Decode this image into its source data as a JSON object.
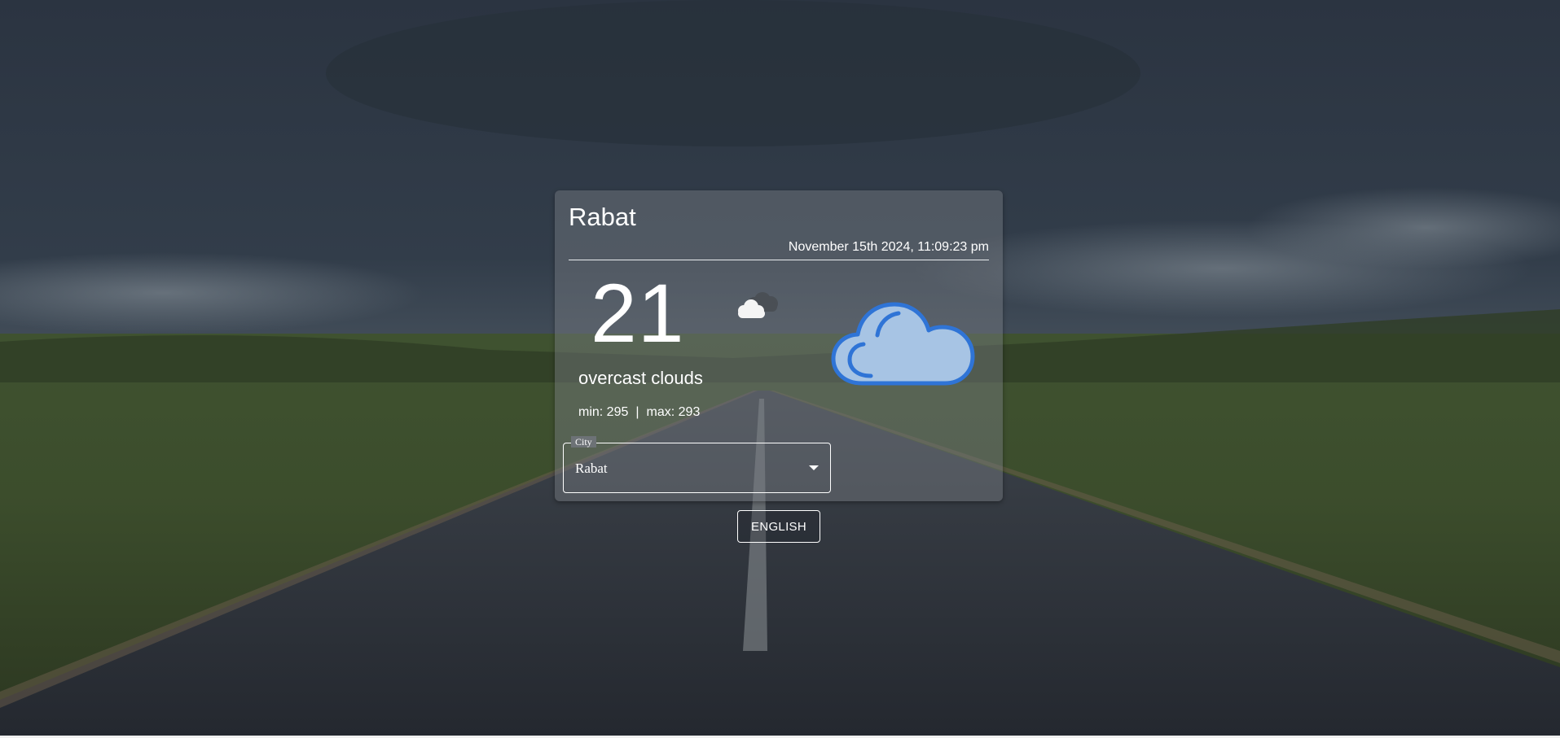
{
  "weather": {
    "city": "Rabat",
    "datetime": "November 15th 2024, 11:09:23 pm",
    "temperature": "21",
    "description": "overcast clouds",
    "min_label": "min: 295",
    "separator": "|",
    "max_label": "max: 293",
    "small_icon": "cloud-dark-cloud-icon",
    "large_icon": "cloud-icon"
  },
  "city_select": {
    "label": "City",
    "value": "Rabat",
    "arrow_icon": "caret-down-icon"
  },
  "language_button": {
    "label": "ENGLISH"
  },
  "colors": {
    "cloud_fill": "#a7c4e4",
    "cloud_stroke": "#2f74d6",
    "card_bg": "rgba(120,125,130,0.45)",
    "text": "#ffffff"
  }
}
